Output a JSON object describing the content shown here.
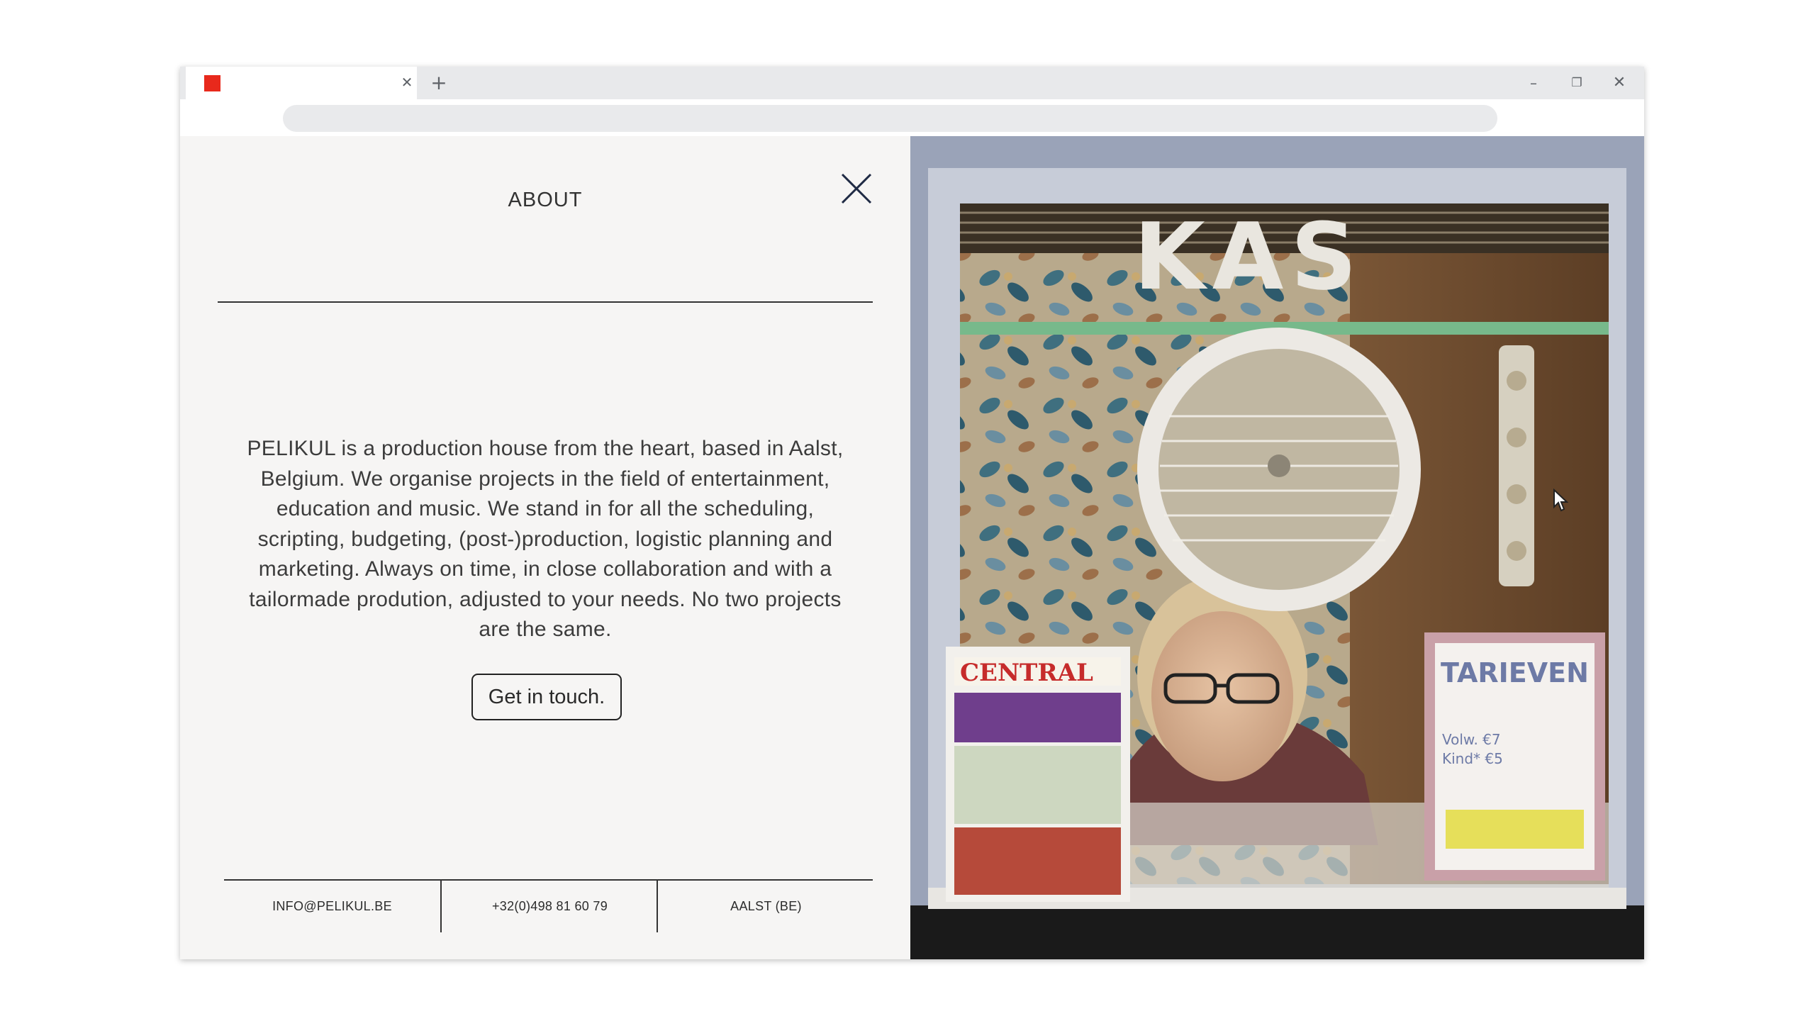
{
  "browser": {
    "tab": {
      "title": "",
      "favicon_color": "#e8291c",
      "close_icon": "close-icon"
    },
    "new_tab_symbol": "+",
    "window_controls": {
      "minimize": "–",
      "restore": "❐",
      "close": "✕"
    },
    "address_bar": {
      "value": "",
      "placeholder": ""
    }
  },
  "about": {
    "title": "ABOUT",
    "close_icon": "close-x-icon",
    "body": "PELIKUL is a production house from the heart, based in Aalst, Belgium. We organise projects in the field of entertainment, education and music. We stand in for all the scheduling, scripting, budgeting, (post-)production, logistic planning and marketing. Always on time, in close collaboration and with a tailormade prodution, adjusted to your needs. No two projects are the same.",
    "cta_label": "Get in touch."
  },
  "footer": {
    "email": "INFO@PELIKUL.BE",
    "phone": "+32(0)498 81 60 79",
    "location": "AALST (BE)"
  },
  "photo": {
    "sign_text": "KAS",
    "poster_left": "CENTRAL",
    "poster_right_title": "TARIEVEN",
    "poster_right_lines": [
      "Volw. €7",
      "Kind* €5"
    ]
  }
}
